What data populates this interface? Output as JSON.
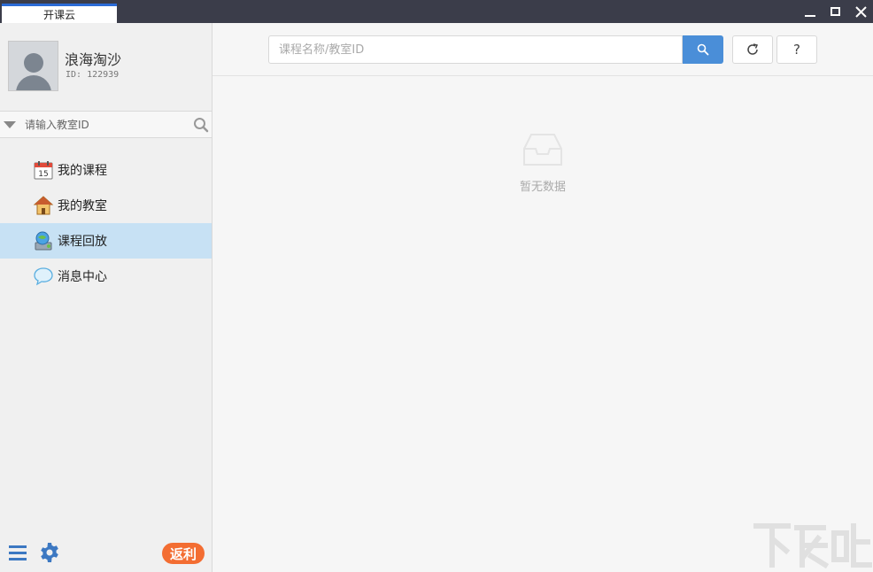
{
  "window": {
    "tab_title": "开课云"
  },
  "profile": {
    "name": "浪海淘沙",
    "id_text": "ID: 122939"
  },
  "room_search": {
    "placeholder": "请输入教室ID"
  },
  "nav": {
    "items": [
      {
        "label": "我的课程",
        "icon": "calendar-icon",
        "active": false
      },
      {
        "label": "我的教室",
        "icon": "house-icon",
        "active": false
      },
      {
        "label": "课程回放",
        "icon": "playback-icon",
        "active": true
      },
      {
        "label": "消息中心",
        "icon": "chat-bubble-icon",
        "active": false
      }
    ]
  },
  "footer": {
    "rebate_label": "返利"
  },
  "toolbar": {
    "search_placeholder": "课程名称/教室ID",
    "help_label": "?"
  },
  "empty_state": {
    "text": "暂无数据"
  },
  "colors": {
    "titlebar": "#3b3d4a",
    "accent_blue": "#4a8ed8",
    "active_nav": "#c7e1f4",
    "rebate_orange": "#f36d32"
  }
}
